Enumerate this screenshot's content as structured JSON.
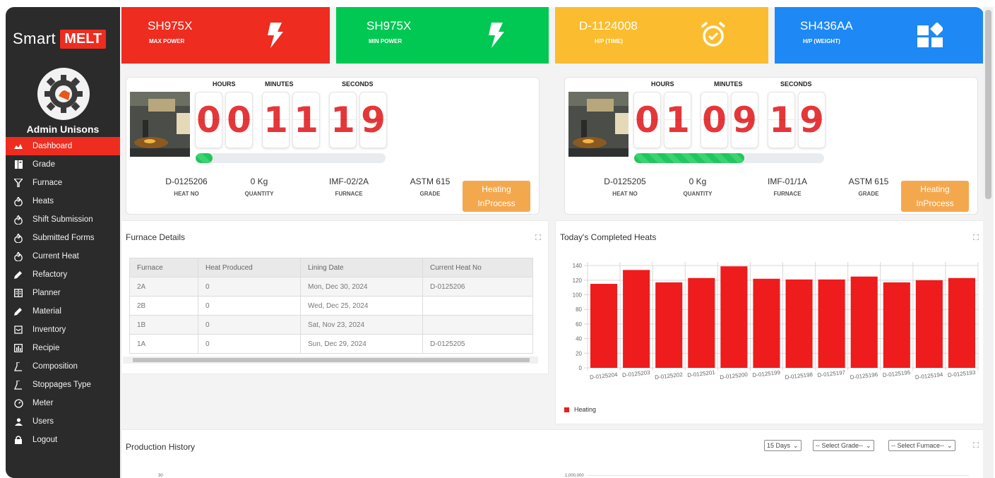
{
  "brand": {
    "text": "Smart",
    "badge": "MELT"
  },
  "user": {
    "name": "Admin Unisons"
  },
  "menu": [
    {
      "label": "Dashboard",
      "icon": "dashboard-icon"
    },
    {
      "label": "Grade",
      "icon": "book-icon"
    },
    {
      "label": "Furnace",
      "icon": "filter-icon"
    },
    {
      "label": "Heats",
      "icon": "fire-icon"
    },
    {
      "label": "Shift Submission",
      "icon": "fire-icon"
    },
    {
      "label": "Submitted Forms",
      "icon": "fire-icon"
    },
    {
      "label": "Current Heat",
      "icon": "fire-icon"
    },
    {
      "label": "Refactory",
      "icon": "pencil-icon"
    },
    {
      "label": "Planner",
      "icon": "book-icon"
    },
    {
      "label": "Material",
      "icon": "pencil-icon"
    },
    {
      "label": "Inventory",
      "icon": "basket-icon"
    },
    {
      "label": "Recipie",
      "icon": "chart-icon"
    },
    {
      "label": "Composition",
      "icon": "flask-icon"
    },
    {
      "label": "Stoppages Type",
      "icon": "flask-icon"
    },
    {
      "label": "Meter",
      "icon": "gauge-icon"
    },
    {
      "label": "Users",
      "icon": "user-icon"
    },
    {
      "label": "Logout",
      "icon": "lock-icon"
    }
  ],
  "cards": [
    {
      "title": "SH975X",
      "sub": "MAX POWER",
      "color": "#ee2c1f",
      "icon": "bolt-icon"
    },
    {
      "title": "SH975X",
      "sub": "MIN POWER",
      "color": "#00c853",
      "icon": "bolt-icon"
    },
    {
      "title": "D-1124008",
      "sub": "H/P (TIME)",
      "color": "#fbbd2f",
      "icon": "alarm-clock-icon"
    },
    {
      "title": "SH436AA",
      "sub": "H/P (WEIGHT)",
      "color": "#1e88f5",
      "icon": "widgets-icon"
    }
  ],
  "timers": [
    {
      "labels": {
        "hours": "HOURS",
        "minutes": "MINUTES",
        "seconds": "SECONDS"
      },
      "digits": [
        "0",
        "0",
        "1",
        "1",
        "1",
        "9"
      ],
      "progress": 0.09,
      "heat_no": "D-0125206",
      "heat_no_label": "HEAT NO",
      "quantity": "0 Kg",
      "quantity_label": "QUANTITY",
      "furnace": "IMF-02/2A",
      "furnace_label": "FURNACE",
      "grade": "ASTM 615",
      "grade_label": "GRADE",
      "status_line1": "Heating",
      "status_line2": "InProcess"
    },
    {
      "labels": {
        "hours": "HOURS",
        "minutes": "MINUTES",
        "seconds": "SECONDS"
      },
      "digits": [
        "0",
        "1",
        "0",
        "9",
        "1",
        "9"
      ],
      "progress": 0.58,
      "heat_no": "D-0125205",
      "heat_no_label": "HEAT NO",
      "quantity": "0 Kg",
      "quantity_label": "QUANTITY",
      "furnace": "IMF-01/1A",
      "furnace_label": "FURNACE",
      "grade": "ASTM 615",
      "grade_label": "GRADE",
      "status_line1": "Heating",
      "status_line2": "InProcess"
    }
  ],
  "furnace_details": {
    "title": "Furnace Details",
    "columns": [
      "Furnace",
      "Heat Produced",
      "Lining Date",
      "Current Heat No"
    ],
    "rows": [
      [
        "2A",
        "0",
        "Mon, Dec 30, 2024",
        "D-0125206"
      ],
      [
        "2B",
        "0",
        "Wed, Dec 25, 2024",
        ""
      ],
      [
        "1B",
        "0",
        "Sat, Nov 23, 2024",
        ""
      ],
      [
        "1A",
        "0",
        "Sun, Dec 29, 2024",
        "D-0125205"
      ]
    ]
  },
  "completed_heats": {
    "title": "Today's Completed Heats",
    "legend": "Heating"
  },
  "chart_data": {
    "type": "bar",
    "title": "Today's Completed Heats",
    "categories": [
      "D-0125204",
      "D-0125203",
      "D-0125202",
      "D-0125201",
      "D-0125200",
      "D-0125199",
      "D-0125198",
      "D-0125197",
      "D-0125196",
      "D-0125195",
      "D-0125194",
      "D-0125193"
    ],
    "series": [
      {
        "name": "Heating",
        "values": [
          115,
          134,
          117,
          123,
          139,
          122,
          121,
          121,
          125,
          117,
          120,
          123
        ],
        "color": "#ee1c1c"
      }
    ],
    "yticks": [
      "0",
      "20",
      "40",
      "60",
      "80",
      "100",
      "120",
      "140"
    ],
    "ylim": [
      0,
      145
    ],
    "grid": true,
    "legend": "bottom-left"
  },
  "production_history": {
    "title": "Production History",
    "days": "15 Days",
    "grade": "-- Select Grade--",
    "furnace": "-- Select Furnace--",
    "left_axis_top": "30",
    "right_axis_top": "1,000,000"
  }
}
